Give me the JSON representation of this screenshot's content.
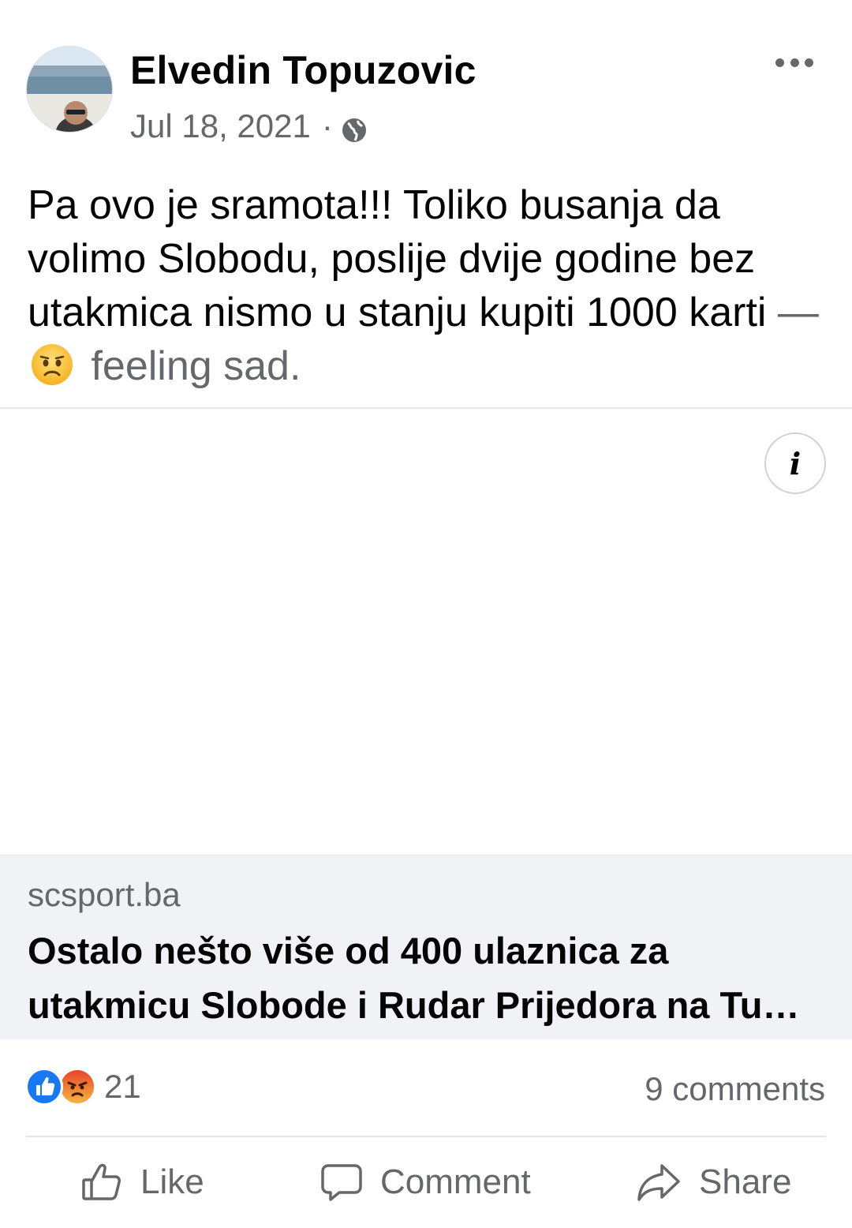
{
  "post": {
    "author": "Elvedin Topuzovic",
    "date": "Jul 18, 2021",
    "separator": "·",
    "privacy_icon": "globe-icon",
    "text": "Pa ovo je sramota!!! Toliko busanja da volimo Slobodu, poslije dvije godine bez utakmica nismo u stanju kupiti 1000 karti",
    "feeling_dash": "—",
    "feeling_emoji": "sad-face-emoji",
    "feeling_label": "feeling sad."
  },
  "link_preview": {
    "domain": "scsport.ba",
    "title": "Ostalo nešto više od 400 ulaznica za utakmicu Slobode i Rudar Prijedora na Tu…"
  },
  "stats": {
    "reaction_icons": [
      "like-reaction-icon",
      "angry-reaction-icon"
    ],
    "reaction_count": "21",
    "comments": "9 comments"
  },
  "actions": {
    "like": "Like",
    "comment": "Comment",
    "share": "Share"
  },
  "colors": {
    "text_primary": "#050505",
    "text_secondary": "#65676b",
    "link_box_bg": "#f0f2f5",
    "like_blue": "#1877f2",
    "angry_orange": "#f5702a"
  }
}
